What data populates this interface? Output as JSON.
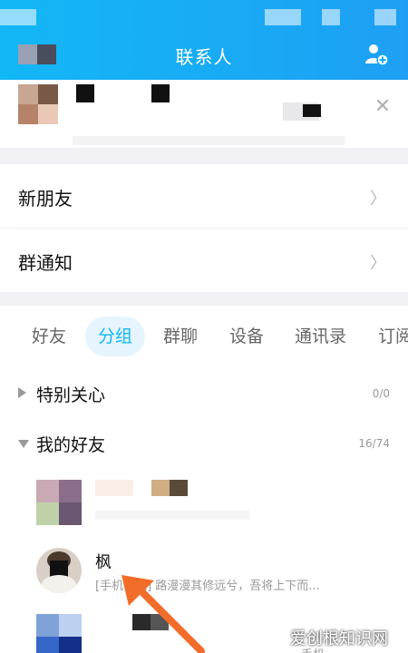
{
  "header": {
    "title": "联系人",
    "add_icon": "add-friend-icon",
    "brand_color": "#12b7f5"
  },
  "notice_card": {
    "close_icon": "close-icon"
  },
  "menu": {
    "new_friends": "新朋友",
    "group_notice": "群通知",
    "chevron_icon": "chevron-right-icon"
  },
  "tabs": [
    {
      "label": "好友",
      "active": false
    },
    {
      "label": "分组",
      "active": true
    },
    {
      "label": "群聊",
      "active": false
    },
    {
      "label": "设备",
      "active": false
    },
    {
      "label": "通讯录",
      "active": false
    },
    {
      "label": "订阅",
      "active": false
    }
  ],
  "groups": [
    {
      "name": "特别关心",
      "count": "0/0",
      "expanded": false
    },
    {
      "name": "我的好友",
      "count": "16/74",
      "expanded": true
    }
  ],
  "contacts": [
    {
      "name": "",
      "status": ""
    },
    {
      "name": "枫",
      "status": "[手机在线] 路漫漫其修远兮，吾将上下而..."
    },
    {
      "name": "",
      "status": "手机"
    }
  ],
  "watermark": "爱创根知识网"
}
